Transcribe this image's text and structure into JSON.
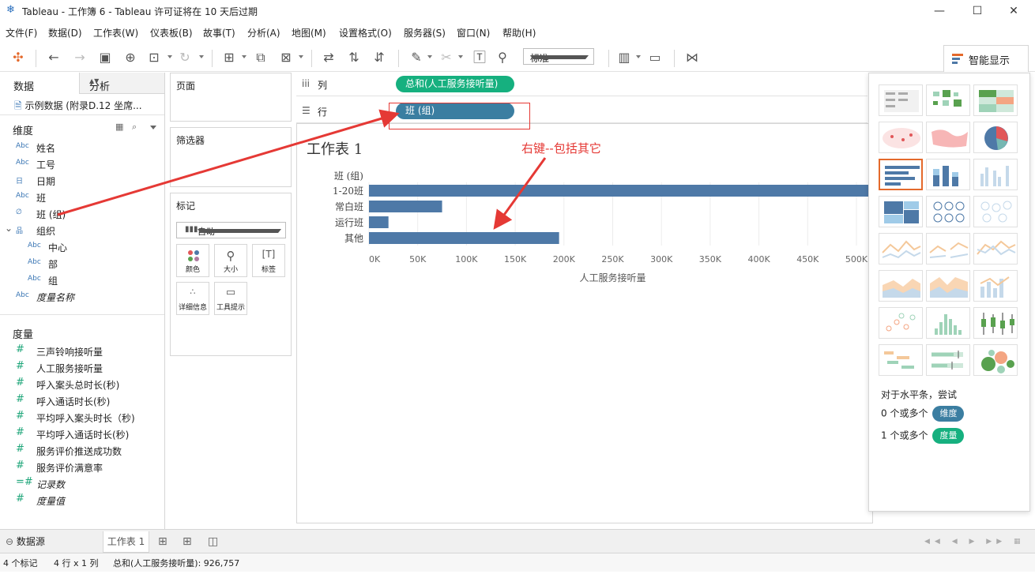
{
  "window": {
    "title": "Tableau - 工作簿 6 - Tableau 许可证将在 10 天后过期",
    "minimize": "—",
    "maximize": "☐",
    "close": "✕"
  },
  "menu": [
    "文件(F)",
    "数据(D)",
    "工作表(W)",
    "仪表板(B)",
    "故事(T)",
    "分析(A)",
    "地图(M)",
    "设置格式(O)",
    "服务器(S)",
    "窗口(N)",
    "帮助(H)"
  ],
  "toolbar": {
    "fit_select": "标准",
    "show_me": "智能显示"
  },
  "data_pane": {
    "tab_data": "数据",
    "tab_analysis": "分析",
    "datasource": "示例数据 (附录D.12 坐席...",
    "dimensions_title": "维度",
    "dimensions": [
      {
        "type": "Abc",
        "name": "姓名"
      },
      {
        "type": "Abc",
        "name": "工号"
      },
      {
        "type": "日",
        "name": "日期"
      },
      {
        "type": "Abc",
        "name": "班"
      },
      {
        "type": "∅",
        "name": "班 (组)"
      },
      {
        "type": "品",
        "name": "组织"
      },
      {
        "type": "Abc",
        "name": "中心"
      },
      {
        "type": "Abc",
        "name": "部"
      },
      {
        "type": "Abc",
        "name": "组"
      },
      {
        "type": "Abc",
        "name": "度量名称"
      }
    ],
    "measures_title": "度量",
    "measures": [
      {
        "type": "#",
        "name": "三声铃响接听量"
      },
      {
        "type": "#",
        "name": "人工服务接听量"
      },
      {
        "type": "#",
        "name": "呼入案头总时长(秒)"
      },
      {
        "type": "#",
        "name": "呼入通话时长(秒)"
      },
      {
        "type": "#",
        "name": "平均呼入案头时长（秒)"
      },
      {
        "type": "#",
        "name": "平均呼入通话时长(秒)"
      },
      {
        "type": "#",
        "name": "服务评价推送成功数"
      },
      {
        "type": "#",
        "name": "服务评价满意率"
      },
      {
        "type": "=#",
        "name": "记录数"
      },
      {
        "type": "#",
        "name": "度量值"
      }
    ]
  },
  "cards": {
    "pages": "页面",
    "filters": "筛选器",
    "marks": "标记",
    "mark_type": "自动",
    "mark_buttons": [
      "颜色",
      "大小",
      "标签",
      "详细信息",
      "工具提示"
    ]
  },
  "shelves": {
    "columns_label": "列",
    "columns_pill": "总和(人工服务接听量)",
    "rows_label": "行",
    "rows_pill": "班 (组)"
  },
  "view": {
    "sheet_title": "工作表 1",
    "annotation": "右键--包括其它"
  },
  "chart_data": {
    "type": "bar",
    "orientation": "horizontal",
    "row_header": "班 (组)",
    "categories": [
      "1-20班",
      "常白班",
      "运行班",
      "其他"
    ],
    "values": [
      520000,
      75000,
      20000,
      195000
    ],
    "xlabel": "人工服务接听量",
    "xticks": [
      "0K",
      "50K",
      "100K",
      "150K",
      "200K",
      "250K",
      "300K",
      "350K",
      "400K",
      "450K",
      "500K"
    ],
    "xlim": [
      0,
      500000
    ],
    "bar_color": "#4e79a7",
    "grid": true
  },
  "show_me": {
    "hint": "对于水平条，尝试",
    "req1_prefix": "0 个或多个",
    "req1_pill": "维度",
    "req2_prefix": "1 个或多个",
    "req2_pill": "度量"
  },
  "sheet_tabs": {
    "datasource": "数据源",
    "sheet1": "工作表 1"
  },
  "status": {
    "marks": "4 个标记",
    "rows_cols": "4 行 x 1 列",
    "sum": "总和(人工服务接听量): 926,757"
  },
  "colors": {
    "dimension_pill": "#3b7ea1",
    "measure_pill": "#16b07f",
    "annotation": "#e53935",
    "selected_chart": "#e4692b"
  }
}
